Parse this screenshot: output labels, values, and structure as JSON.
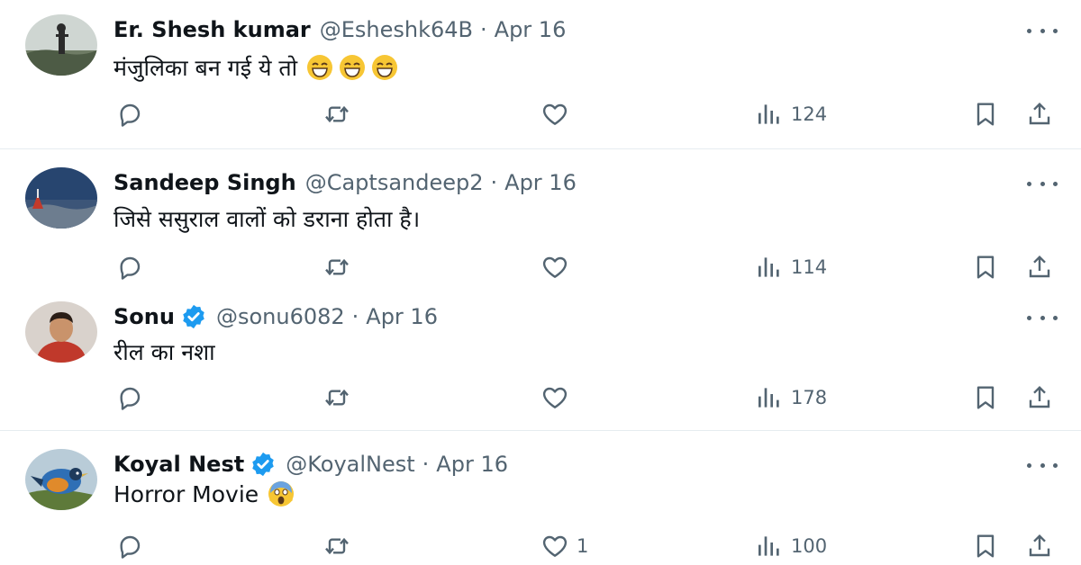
{
  "icons": {
    "reply": "reply-icon",
    "retweet": "retweet-icon",
    "like": "heart-icon",
    "views": "views-icon",
    "bookmark": "bookmark-icon",
    "share": "share-icon",
    "more": "more-icon",
    "verified": "verified-badge-icon"
  },
  "colors": {
    "text": "#0f1419",
    "secondary": "#536471",
    "verified": "#1d9bf0",
    "divider": "#e6ecf0"
  },
  "tweets": [
    {
      "name": "Er. Shesh kumar",
      "handle": "@Esheshk64B",
      "separator": "·",
      "date": "Apr 16",
      "verified": false,
      "text": "मंजुलिका बन गई ये तो",
      "emoji": [
        "grinning-face-emoji",
        "grinning-face-emoji",
        "grinning-face-emoji"
      ],
      "likes": "",
      "views": "124"
    },
    {
      "name": "Sandeep Singh",
      "handle": "@Captsandeep2",
      "separator": "·",
      "date": "Apr 16",
      "verified": false,
      "text": "जिसे ससुराल वालों को डराना होता है।",
      "emoji": [],
      "likes": "",
      "views": "114"
    },
    {
      "name": "Sonu",
      "handle": "@sonu6082",
      "separator": "·",
      "date": "Apr 16",
      "verified": true,
      "text": "रील का नशा",
      "emoji": [],
      "likes": "",
      "views": "178"
    },
    {
      "name": "Koyal Nest",
      "handle": "@KoyalNest",
      "separator": "·",
      "date": "Apr 16",
      "verified": true,
      "text": "Horror Movie",
      "emoji": [
        "screaming-face-emoji"
      ],
      "likes": "1",
      "views": "100"
    }
  ]
}
